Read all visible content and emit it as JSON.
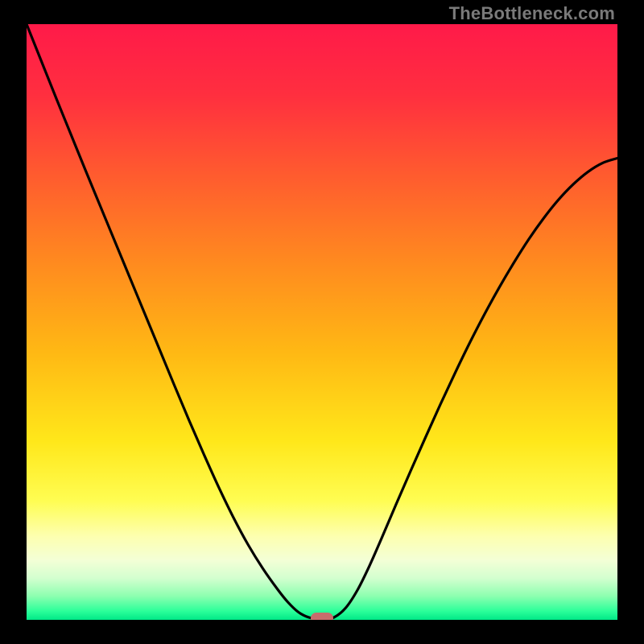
{
  "watermark": "TheBottleneck.com",
  "colors": {
    "frame": "#000000",
    "marker": "#c76d6c",
    "curve": "#000000",
    "gradient_stops": [
      {
        "offset": 0.0,
        "color": "#ff1a49"
      },
      {
        "offset": 0.12,
        "color": "#ff2f3f"
      },
      {
        "offset": 0.25,
        "color": "#ff5a2f"
      },
      {
        "offset": 0.4,
        "color": "#ff8a1f"
      },
      {
        "offset": 0.55,
        "color": "#ffb814"
      },
      {
        "offset": 0.7,
        "color": "#ffe71a"
      },
      {
        "offset": 0.8,
        "color": "#fffd52"
      },
      {
        "offset": 0.86,
        "color": "#fdffb0"
      },
      {
        "offset": 0.9,
        "color": "#f3ffd6"
      },
      {
        "offset": 0.93,
        "color": "#d3ffcf"
      },
      {
        "offset": 0.96,
        "color": "#8dffb0"
      },
      {
        "offset": 0.985,
        "color": "#2dff9a"
      },
      {
        "offset": 1.0,
        "color": "#00e887"
      }
    ]
  },
  "chart_data": {
    "type": "line",
    "title": "",
    "xlabel": "",
    "ylabel": "",
    "xlim": [
      0,
      1
    ],
    "ylim": [
      0,
      1
    ],
    "x": [
      0.0,
      0.025,
      0.05,
      0.075,
      0.1,
      0.125,
      0.15,
      0.175,
      0.2,
      0.225,
      0.25,
      0.275,
      0.3,
      0.325,
      0.35,
      0.375,
      0.4,
      0.425,
      0.442,
      0.46,
      0.478,
      0.5,
      0.52,
      0.54,
      0.56,
      0.58,
      0.6,
      0.625,
      0.65,
      0.675,
      0.7,
      0.725,
      0.75,
      0.775,
      0.8,
      0.825,
      0.85,
      0.875,
      0.9,
      0.925,
      0.95,
      0.975,
      1.0
    ],
    "values": [
      1.0,
      0.938,
      0.876,
      0.815,
      0.754,
      0.694,
      0.634,
      0.574,
      0.514,
      0.454,
      0.394,
      0.335,
      0.278,
      0.223,
      0.172,
      0.126,
      0.086,
      0.051,
      0.03,
      0.013,
      0.004,
      0.0,
      0.004,
      0.02,
      0.05,
      0.09,
      0.135,
      0.193,
      0.25,
      0.306,
      0.361,
      0.414,
      0.465,
      0.513,
      0.558,
      0.6,
      0.639,
      0.674,
      0.705,
      0.731,
      0.752,
      0.767,
      0.775
    ],
    "annotations": [
      {
        "kind": "marker",
        "x": 0.5,
        "y": 0.003
      }
    ],
    "notes": "V-shaped bottleneck curve over a vertical red→yellow→green gradient; minimum at x≈0.50. Axes are unlabeled; values are normalized to plot-area fractions (0 at bottom/left, 1 at top/right)."
  }
}
